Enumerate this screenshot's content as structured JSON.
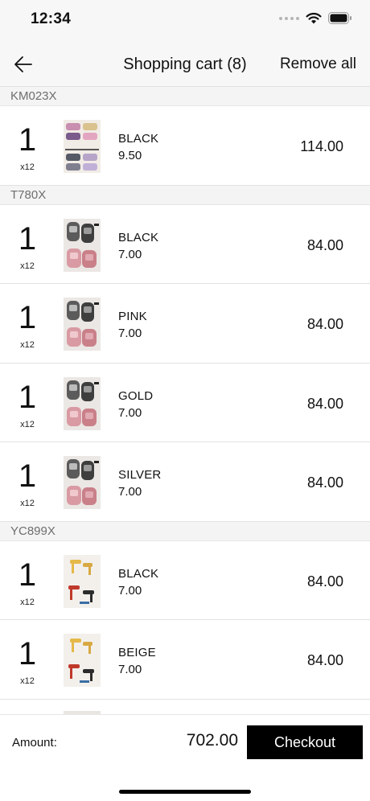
{
  "status_bar": {
    "time": "12:34"
  },
  "nav": {
    "title": "Shopping cart (8)",
    "remove_all": "Remove all"
  },
  "groups": [
    {
      "code": "KM023X",
      "items": [
        {
          "qty": "1",
          "mult": "x12",
          "color": "BLACK",
          "unit_price": "9.50",
          "total": "114.00",
          "thumb": "multi"
        }
      ]
    },
    {
      "code": "T780X",
      "items": [
        {
          "qty": "1",
          "mult": "x12",
          "color": "BLACK",
          "unit_price": "7.00",
          "total": "84.00",
          "thumb": "slide"
        },
        {
          "qty": "1",
          "mult": "x12",
          "color": "PINK",
          "unit_price": "7.00",
          "total": "84.00",
          "thumb": "slide"
        },
        {
          "qty": "1",
          "mult": "x12",
          "color": "GOLD",
          "unit_price": "7.00",
          "total": "84.00",
          "thumb": "slide"
        },
        {
          "qty": "1",
          "mult": "x12",
          "color": "SILVER",
          "unit_price": "7.00",
          "total": "84.00",
          "thumb": "slide"
        }
      ]
    },
    {
      "code": "YC899X",
      "items": [
        {
          "qty": "1",
          "mult": "x12",
          "color": "BLACK",
          "unit_price": "7.00",
          "total": "84.00",
          "thumb": "heel"
        },
        {
          "qty": "1",
          "mult": "x12",
          "color": "BEIGE",
          "unit_price": "7.00",
          "total": "84.00",
          "thumb": "heel"
        }
      ]
    }
  ],
  "footer": {
    "amount_label": "Amount:",
    "amount_value": "702.00",
    "checkout_label": "Checkout"
  },
  "icons": {
    "back": "arrow-left-icon",
    "wifi": "wifi-icon",
    "battery": "battery-icon",
    "signal": "signal-icon"
  },
  "colors": {
    "accent": "#000000",
    "header_bg": "#f7f7f7",
    "group_bg": "#f4f4f4",
    "group_text": "#6e6e6e"
  }
}
